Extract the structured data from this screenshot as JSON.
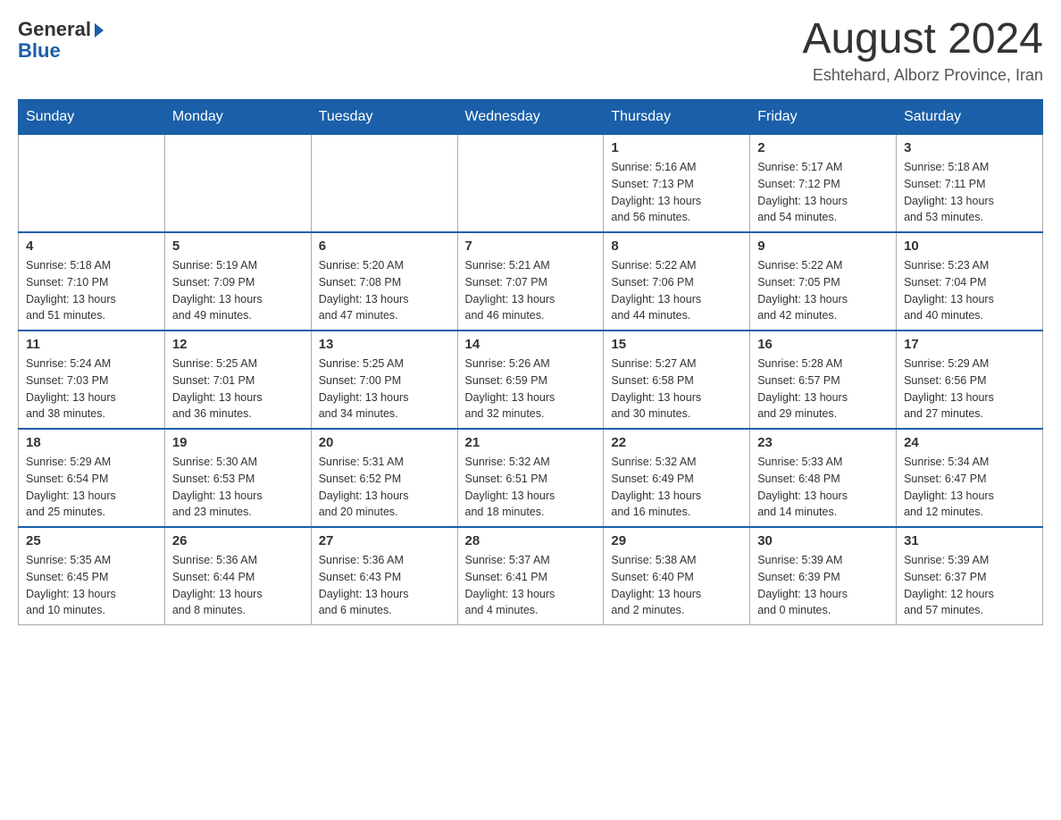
{
  "header": {
    "logo_general": "General",
    "logo_blue": "Blue",
    "month_title": "August 2024",
    "subtitle": "Eshtehard, Alborz Province, Iran"
  },
  "weekdays": [
    "Sunday",
    "Monday",
    "Tuesday",
    "Wednesday",
    "Thursday",
    "Friday",
    "Saturday"
  ],
  "weeks": [
    [
      {
        "day": "",
        "info": ""
      },
      {
        "day": "",
        "info": ""
      },
      {
        "day": "",
        "info": ""
      },
      {
        "day": "",
        "info": ""
      },
      {
        "day": "1",
        "info": "Sunrise: 5:16 AM\nSunset: 7:13 PM\nDaylight: 13 hours\nand 56 minutes."
      },
      {
        "day": "2",
        "info": "Sunrise: 5:17 AM\nSunset: 7:12 PM\nDaylight: 13 hours\nand 54 minutes."
      },
      {
        "day": "3",
        "info": "Sunrise: 5:18 AM\nSunset: 7:11 PM\nDaylight: 13 hours\nand 53 minutes."
      }
    ],
    [
      {
        "day": "4",
        "info": "Sunrise: 5:18 AM\nSunset: 7:10 PM\nDaylight: 13 hours\nand 51 minutes."
      },
      {
        "day": "5",
        "info": "Sunrise: 5:19 AM\nSunset: 7:09 PM\nDaylight: 13 hours\nand 49 minutes."
      },
      {
        "day": "6",
        "info": "Sunrise: 5:20 AM\nSunset: 7:08 PM\nDaylight: 13 hours\nand 47 minutes."
      },
      {
        "day": "7",
        "info": "Sunrise: 5:21 AM\nSunset: 7:07 PM\nDaylight: 13 hours\nand 46 minutes."
      },
      {
        "day": "8",
        "info": "Sunrise: 5:22 AM\nSunset: 7:06 PM\nDaylight: 13 hours\nand 44 minutes."
      },
      {
        "day": "9",
        "info": "Sunrise: 5:22 AM\nSunset: 7:05 PM\nDaylight: 13 hours\nand 42 minutes."
      },
      {
        "day": "10",
        "info": "Sunrise: 5:23 AM\nSunset: 7:04 PM\nDaylight: 13 hours\nand 40 minutes."
      }
    ],
    [
      {
        "day": "11",
        "info": "Sunrise: 5:24 AM\nSunset: 7:03 PM\nDaylight: 13 hours\nand 38 minutes."
      },
      {
        "day": "12",
        "info": "Sunrise: 5:25 AM\nSunset: 7:01 PM\nDaylight: 13 hours\nand 36 minutes."
      },
      {
        "day": "13",
        "info": "Sunrise: 5:25 AM\nSunset: 7:00 PM\nDaylight: 13 hours\nand 34 minutes."
      },
      {
        "day": "14",
        "info": "Sunrise: 5:26 AM\nSunset: 6:59 PM\nDaylight: 13 hours\nand 32 minutes."
      },
      {
        "day": "15",
        "info": "Sunrise: 5:27 AM\nSunset: 6:58 PM\nDaylight: 13 hours\nand 30 minutes."
      },
      {
        "day": "16",
        "info": "Sunrise: 5:28 AM\nSunset: 6:57 PM\nDaylight: 13 hours\nand 29 minutes."
      },
      {
        "day": "17",
        "info": "Sunrise: 5:29 AM\nSunset: 6:56 PM\nDaylight: 13 hours\nand 27 minutes."
      }
    ],
    [
      {
        "day": "18",
        "info": "Sunrise: 5:29 AM\nSunset: 6:54 PM\nDaylight: 13 hours\nand 25 minutes."
      },
      {
        "day": "19",
        "info": "Sunrise: 5:30 AM\nSunset: 6:53 PM\nDaylight: 13 hours\nand 23 minutes."
      },
      {
        "day": "20",
        "info": "Sunrise: 5:31 AM\nSunset: 6:52 PM\nDaylight: 13 hours\nand 20 minutes."
      },
      {
        "day": "21",
        "info": "Sunrise: 5:32 AM\nSunset: 6:51 PM\nDaylight: 13 hours\nand 18 minutes."
      },
      {
        "day": "22",
        "info": "Sunrise: 5:32 AM\nSunset: 6:49 PM\nDaylight: 13 hours\nand 16 minutes."
      },
      {
        "day": "23",
        "info": "Sunrise: 5:33 AM\nSunset: 6:48 PM\nDaylight: 13 hours\nand 14 minutes."
      },
      {
        "day": "24",
        "info": "Sunrise: 5:34 AM\nSunset: 6:47 PM\nDaylight: 13 hours\nand 12 minutes."
      }
    ],
    [
      {
        "day": "25",
        "info": "Sunrise: 5:35 AM\nSunset: 6:45 PM\nDaylight: 13 hours\nand 10 minutes."
      },
      {
        "day": "26",
        "info": "Sunrise: 5:36 AM\nSunset: 6:44 PM\nDaylight: 13 hours\nand 8 minutes."
      },
      {
        "day": "27",
        "info": "Sunrise: 5:36 AM\nSunset: 6:43 PM\nDaylight: 13 hours\nand 6 minutes."
      },
      {
        "day": "28",
        "info": "Sunrise: 5:37 AM\nSunset: 6:41 PM\nDaylight: 13 hours\nand 4 minutes."
      },
      {
        "day": "29",
        "info": "Sunrise: 5:38 AM\nSunset: 6:40 PM\nDaylight: 13 hours\nand 2 minutes."
      },
      {
        "day": "30",
        "info": "Sunrise: 5:39 AM\nSunset: 6:39 PM\nDaylight: 13 hours\nand 0 minutes."
      },
      {
        "day": "31",
        "info": "Sunrise: 5:39 AM\nSunset: 6:37 PM\nDaylight: 12 hours\nand 57 minutes."
      }
    ]
  ]
}
